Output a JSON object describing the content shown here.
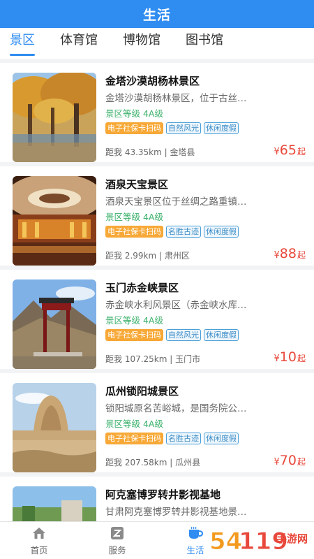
{
  "header": {
    "title": "生活"
  },
  "tabs": [
    {
      "label": "景区",
      "active": true
    },
    {
      "label": "体育馆",
      "active": false
    },
    {
      "label": "博物馆",
      "active": false
    },
    {
      "label": "图书馆",
      "active": false
    }
  ],
  "spots": [
    {
      "name": "金塔沙漠胡杨林景区",
      "desc": "金塔沙漠胡杨林景区，位于古丝…",
      "level": "景区等级 4A级",
      "tags": [
        "电子社保卡扫码",
        "自然风光",
        "休闲度假"
      ],
      "distance": "距我 43.35km | 金塔县",
      "price_symbol": "¥",
      "price": "65",
      "price_unit": "起"
    },
    {
      "name": "酒泉天宝景区",
      "desc": "酒泉天宝景区位于丝绸之路重镇…",
      "level": "景区等级 4A级",
      "tags": [
        "电子社保卡扫码",
        "名胜古迹",
        "休闲度假"
      ],
      "distance": "距我 2.99km | 肃州区",
      "price_symbol": "¥",
      "price": "88",
      "price_unit": "起"
    },
    {
      "name": "玉门赤金峡景区",
      "desc": "赤金峡水利风景区（赤金峡水库…",
      "level": "景区等级 4A级",
      "tags": [
        "电子社保卡扫码",
        "自然风光",
        "休闲度假"
      ],
      "distance": "距我 107.25km | 玉门市",
      "price_symbol": "¥",
      "price": "10",
      "price_unit": "起"
    },
    {
      "name": "瓜州锁阳城景区",
      "desc": "锁阳城原名苦峪城，是国务院公…",
      "level": "景区等级 4A级",
      "tags": [
        "电子社保卡扫码",
        "名胜古迹",
        "休闲度假"
      ],
      "distance": "距我 207.58km | 瓜州县",
      "price_symbol": "¥",
      "price": "70",
      "price_unit": "起"
    },
    {
      "name": "阿克塞博罗转井影视基地",
      "desc": "甘肃阿克塞博罗转井影视基地景…",
      "level": "",
      "tags": [],
      "distance": "",
      "price_symbol": "",
      "price": "",
      "price_unit": ""
    }
  ],
  "tabbar": [
    {
      "label": "首页",
      "icon": "home-icon",
      "active": false
    },
    {
      "label": "服务",
      "icon": "service-icon",
      "active": false
    },
    {
      "label": "生活",
      "icon": "coffee-cup-icon",
      "active": true
    }
  ],
  "watermark": {
    "text": "54119手游网"
  },
  "colors": {
    "primary": "#2f8cf0",
    "price": "#e8483b",
    "level": "#3ab06a",
    "tag_orange": "#f7a836"
  }
}
